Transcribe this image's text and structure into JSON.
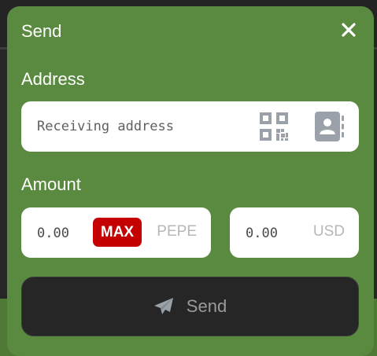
{
  "modal": {
    "title": "Send",
    "close_icon": "close-icon"
  },
  "address": {
    "label": "Address",
    "placeholder": "Receiving address",
    "value": "",
    "qr_icon": "qr-code-icon",
    "contacts_icon": "address-book-icon"
  },
  "amount": {
    "label": "Amount",
    "crypto": {
      "placeholder": "0.00",
      "value": "",
      "max_label": "MAX",
      "unit": "PEPE"
    },
    "fiat": {
      "placeholder": "0.00",
      "value": "",
      "unit": "USD"
    }
  },
  "send_button": {
    "label": "Send",
    "icon": "paper-plane-icon"
  },
  "colors": {
    "modal_bg": "#5a8a3f",
    "max_button": "#c40000",
    "send_button_bg": "#262626",
    "icon_gray": "#9aa1a8"
  }
}
